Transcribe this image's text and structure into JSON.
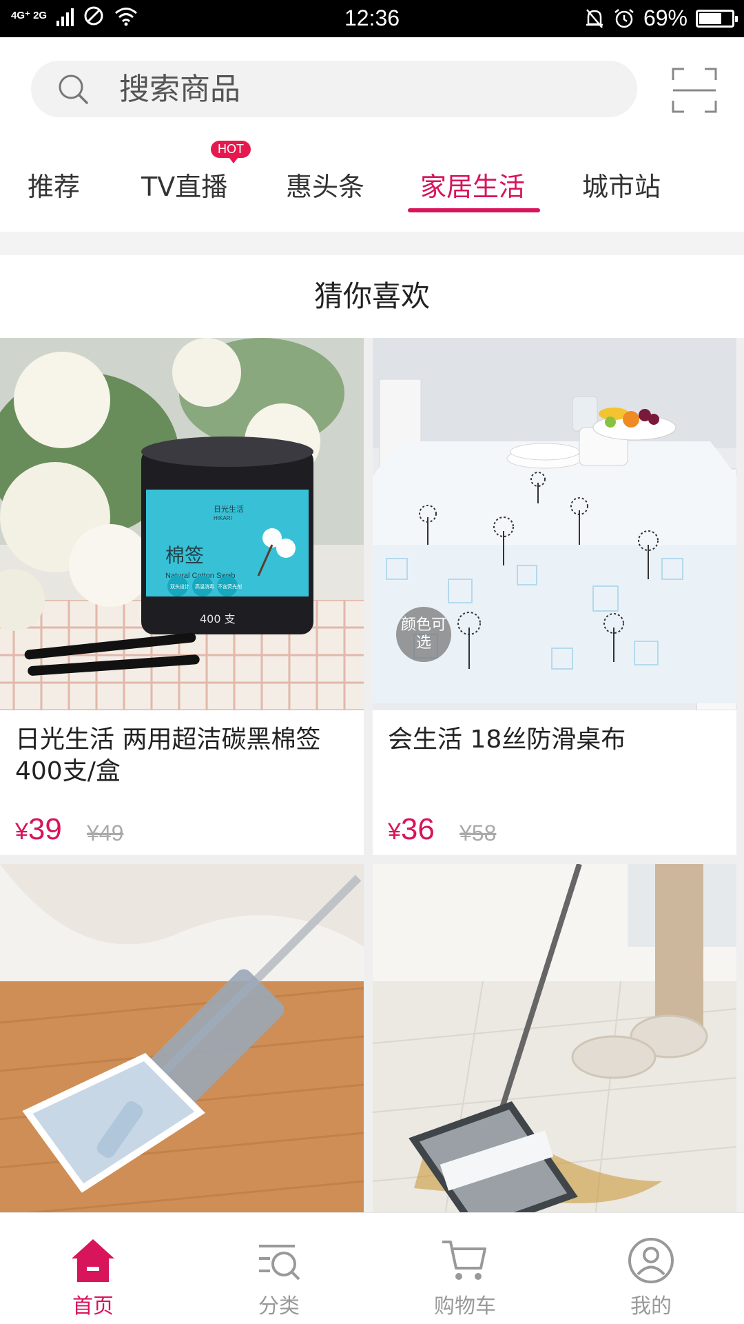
{
  "status_bar": {
    "network": "4G⁺ 2G",
    "time": "12:36",
    "battery_text": "69%",
    "battery_level": 0.69
  },
  "search": {
    "placeholder": "搜索商品"
  },
  "tabs": [
    {
      "label": "推荐",
      "active": false
    },
    {
      "label": "TV直播",
      "active": false,
      "badge": "HOT"
    },
    {
      "label": "惠头条",
      "active": false
    },
    {
      "label": "家居生活",
      "active": true
    },
    {
      "label": "城市站",
      "active": false
    }
  ],
  "section_title": "猜你喜欢",
  "products": [
    {
      "name": "日光生活 两用超洁碳黑棉签400支/盒",
      "price_symbol": "¥",
      "price": "39",
      "original_price": "¥49",
      "package_texts": {
        "brand_cn": "日光生活",
        "brand_en": "HIKARI",
        "title_cn": "棉签",
        "title_en": "Natural Cotton Swab",
        "count": "400 支",
        "feature_1": "双头设计",
        "feature_2": "高温消毒",
        "feature_3": "不含荧光剂"
      }
    },
    {
      "name": "会生活 18丝防滑桌布",
      "price_symbol": "¥",
      "price": "36",
      "original_price": "¥58",
      "badge": "颜色可选"
    },
    {
      "name": "",
      "price_symbol": "",
      "price": "",
      "original_price": ""
    },
    {
      "name": "",
      "price_symbol": "",
      "price": "",
      "original_price": ""
    }
  ],
  "bottom_nav": [
    {
      "label": "首页",
      "icon": "home-icon",
      "active": true
    },
    {
      "label": "分类",
      "icon": "category-search-icon",
      "active": false
    },
    {
      "label": "购物车",
      "icon": "cart-icon",
      "active": false
    },
    {
      "label": "我的",
      "icon": "profile-icon",
      "active": false
    }
  ],
  "colors": {
    "accent": "#d8145b",
    "hot_badge": "#e6194f",
    "muted_text": "#999999"
  }
}
